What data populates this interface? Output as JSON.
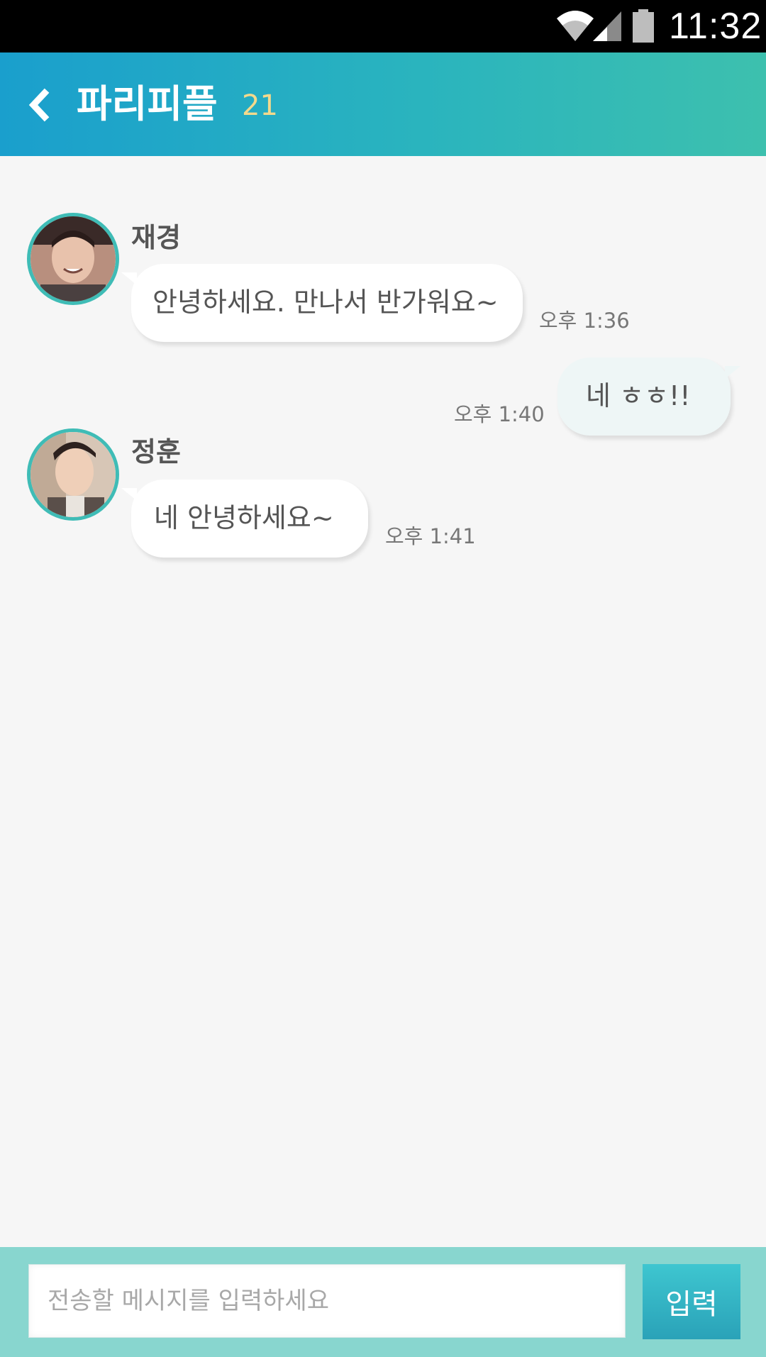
{
  "status_bar": {
    "time": "11:32",
    "icons": [
      "wifi-icon",
      "cellular-signal-icon",
      "battery-icon"
    ]
  },
  "header": {
    "back_icon": "chevron-left-icon",
    "title": "파리피플",
    "member_count": "21"
  },
  "messages": [
    {
      "direction": "incoming",
      "sender": "재경",
      "text": "안녕하세요. 만나서 반가워요~",
      "time": "오후 1:36"
    },
    {
      "direction": "outgoing",
      "text": "네 ㅎㅎ!!",
      "time": "오후 1:40"
    },
    {
      "direction": "incoming",
      "sender": "정훈",
      "text": "네 안녕하세요~",
      "time": "오후 1:41"
    }
  ],
  "composer": {
    "placeholder": "전송할 메시지를 입력하세요",
    "send_label": "입력"
  },
  "colors": {
    "header_start": "#1a9fcd",
    "header_end": "#3dc0ae",
    "member_count": "#f3d98c",
    "avatar_ring": "#3fbcb6",
    "input_bar": "#88d6cf",
    "send_button": "#2aa2b8"
  }
}
